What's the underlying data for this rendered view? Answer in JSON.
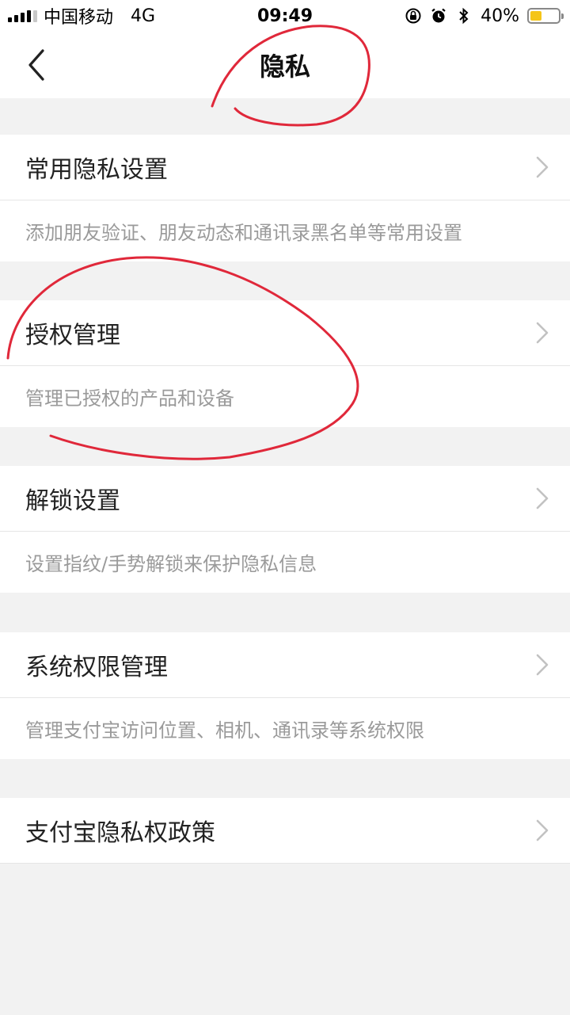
{
  "status_bar": {
    "carrier": "中国移动",
    "network": "4G",
    "time": "09:49",
    "battery": "40%",
    "battery_level": 0.4,
    "icons": [
      "orientation-lock-icon",
      "alarm-icon",
      "bluetooth-icon"
    ]
  },
  "nav": {
    "title": "隐私",
    "back_icon": "chevron-left-icon"
  },
  "sections": [
    {
      "title": "常用隐私设置",
      "desc": "添加朋友验证、朋友动态和通讯录黑名单等常用设置"
    },
    {
      "title": "授权管理",
      "desc": "管理已授权的产品和设备"
    },
    {
      "title": "解锁设置",
      "desc": "设置指纹/手势解锁来保护隐私信息"
    },
    {
      "title": "系统权限管理",
      "desc": "管理支付宝访问位置、相机、通讯录等系统权限"
    },
    {
      "title": "支付宝隐私权政策"
    }
  ],
  "colors": {
    "annotation": "#e0283a",
    "battery_fill": "#f5c518",
    "desc_text": "#9a9a9a",
    "background": "#f2f2f2"
  }
}
